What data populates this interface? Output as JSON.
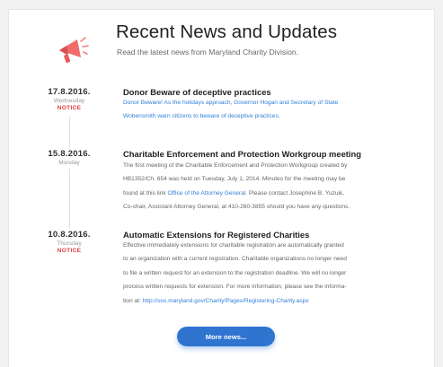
{
  "header": {
    "title": "Recent News and Updates",
    "subtitle": "Read the latest news from Maryland Charity Division.",
    "icon": "megaphone-icon"
  },
  "items": [
    {
      "date": "17.8.2016.",
      "weekday": "Wednesday",
      "notice": "NOTICE",
      "title": "Donor Beware of deceptive practices",
      "body_lines": [
        "Donor Beware! As the holidays approach, Governor Hogan and Secretary of State",
        "Wobensmith warn citizens to beware of deceptive practices."
      ]
    },
    {
      "date": "15.8.2016.",
      "weekday": "Monday",
      "notice": "",
      "title": "Charitable Enforcement and Protection Workgroup meeting",
      "body_lines": [
        "The first meeting of the Charitable Enforcement and Protection Workgroup created by",
        "HB1352/Ch. 654 was held on Tuesday, July 1, 2014. Minutes for the meeting may be",
        "found at this link",
        "Office of the Attorney General",
        ". Please contact Josephine B. Yuzuik,",
        "Co-chair, Assistant Attorney General, at 410-260-3855 should you have any questions."
      ]
    },
    {
      "date": "10.8.2016.",
      "weekday": "Thursday",
      "notice": "NOTICE",
      "title": "Automatic Extensions for Registered Charities",
      "body_lines": [
        "Effective immediately extensions for charitable registration are automatically granted",
        "to an organization with a current registration. Charitable organizations no longer need",
        "to file a written request for an extension to the registration deadline. We will no longer",
        "process written requests for extension. For more information, please see the informa-",
        "tion at:",
        "http://sos.maryland.gov/Charity/Pages/Registering-Charity.aspx"
      ]
    }
  ],
  "more_button": "More news...",
  "colors": {
    "accent": "#2f74cf",
    "link": "#2f7fd8",
    "notice": "#e04040"
  }
}
